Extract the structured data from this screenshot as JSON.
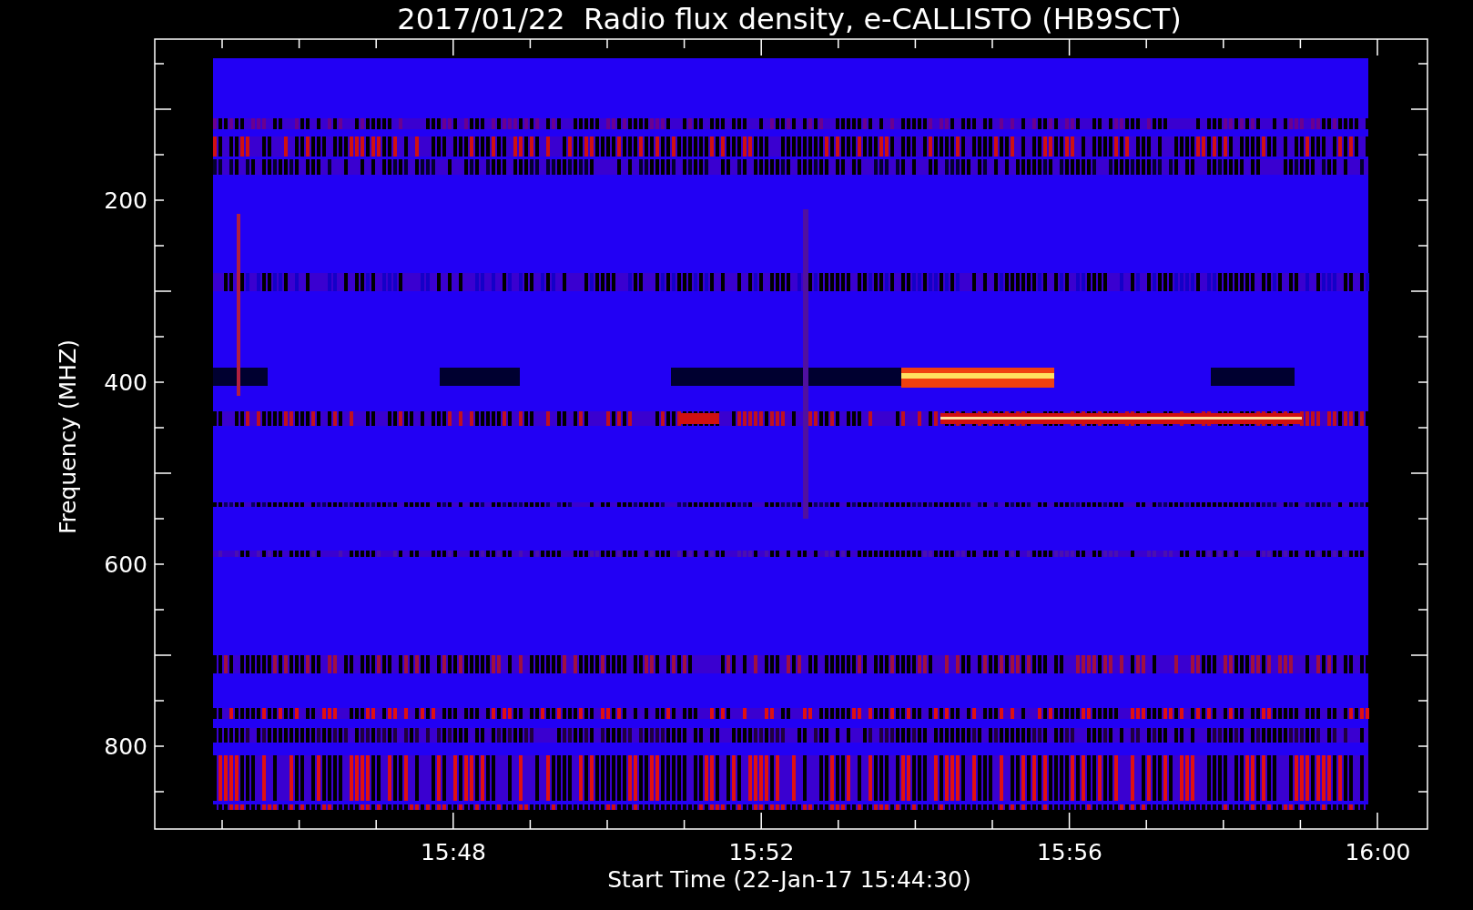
{
  "title": "2017/01/22  Radio flux density, e-CALLISTO (HB9SCT)",
  "y_axis": {
    "label": "Frequency (MHZ)",
    "ticks": [
      "200",
      "400",
      "600",
      "800"
    ]
  },
  "x_axis": {
    "label": "Start Time (22-Jan-17 15:44:30)",
    "ticks": [
      "15:48",
      "15:52",
      "15:56",
      "16:00"
    ]
  }
}
